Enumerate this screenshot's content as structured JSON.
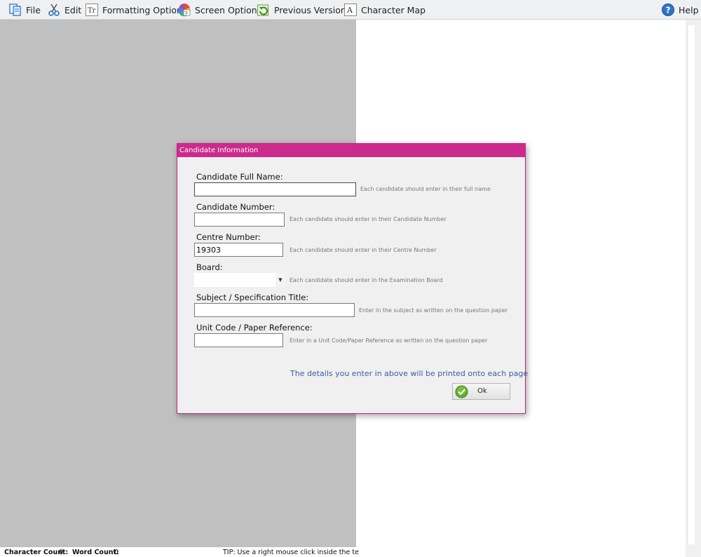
{
  "menu": {
    "file": "File",
    "edit": "Edit",
    "formatting": "Formatting Options",
    "screen": "Screen Options",
    "versions": "Previous Versions",
    "charmap": "Character Map",
    "help": "Help"
  },
  "status": {
    "char_label": "Character Count:",
    "char_value": "0",
    "word_label": "Word Count:",
    "word_value": "0",
    "tip": "TIP: Use a right mouse click inside the textare"
  },
  "dialog": {
    "title": "Candidate Information",
    "fields": {
      "full_name": {
        "label": "Candidate Full Name:",
        "value": "",
        "hint": "Each candidate should enter in their full name"
      },
      "candidate_number": {
        "label": "Candidate Number:",
        "value": "",
        "hint": "Each candidate should enter in their Candidate Number"
      },
      "centre_number": {
        "label": "Centre Number:",
        "value": "19303",
        "hint": "Each candidate should enter in their Centre Number"
      },
      "board": {
        "label": "Board:",
        "value": "",
        "hint": "Each candidate should enter in the Examination Board"
      },
      "subject": {
        "label": "Subject / Specification Title:",
        "value": "",
        "hint": "Enter in the subject as written on the question paper"
      },
      "unit_code": {
        "label": "Unit Code / Paper Reference:",
        "value": "",
        "hint": "Enter in a Unit Code/Paper Reference as written on the question paper"
      }
    },
    "notice": "The details you enter in above will be printed onto each page",
    "ok_label": "Ok"
  },
  "colors": {
    "accent": "#cc2a8c",
    "notice": "#3b5ba8",
    "ok_check": "#5fae2c"
  }
}
